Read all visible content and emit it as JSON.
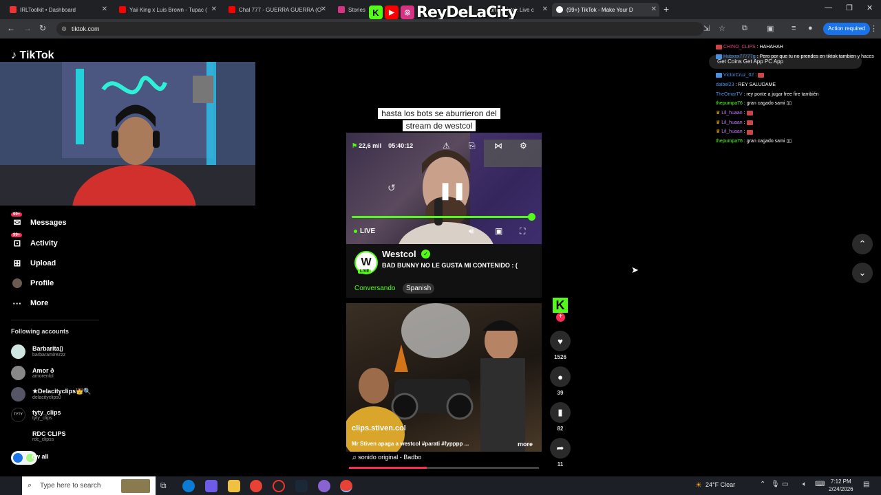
{
  "browser": {
    "tabs": [
      {
        "label": "IRLToolkit • Dashboard",
        "color": "#e33"
      },
      {
        "label": "Yaii King x Luis Brown - Tupac (",
        "color": "#f00"
      },
      {
        "label": "Chal 777 - GUERRA GUERRA (O",
        "color": "#f00"
      },
      {
        "label": "Stories",
        "color": "#d63384"
      },
      {
        "label": "am - Watch Live c",
        "color": "#53fc18"
      },
      {
        "label": "(99+) TikTok - Make Your D",
        "color": "#fff"
      }
    ],
    "url": "tiktok.com",
    "action_required": "Action required"
  },
  "overlay": {
    "name": "ReyDeLaCity"
  },
  "tiktok": {
    "logo": "TikTok",
    "nav": [
      {
        "label": "Messages",
        "badge": "99+",
        "icon": "message-icon"
      },
      {
        "label": "Activity",
        "badge": "99+",
        "icon": "inbox-icon"
      },
      {
        "label": "Upload",
        "badge": "",
        "icon": "upload-icon"
      },
      {
        "label": "Profile",
        "badge": "",
        "icon": "profile-icon"
      },
      {
        "label": "More",
        "badge": "",
        "icon": "more-icon"
      }
    ],
    "following_title": "Following accounts",
    "following": [
      {
        "name": "Barbarita▯",
        "user": "barbaramirezzz",
        "color": "#cfe6e0"
      },
      {
        "name": "Amor ð",
        "user": "amorenlol",
        "color": "#888"
      },
      {
        "name": "★Delacityclips👑🔍",
        "user": "delacityclips0",
        "color": "#556"
      },
      {
        "name": "tyty_clips",
        "user": "tyty_clips",
        "color": "#000"
      },
      {
        "name": "RDC CLIPS",
        "user": "rdc_clipss",
        "color": "#000"
      }
    ],
    "see_all": "ew all"
  },
  "feed": {
    "caption_line1": "hasta los bots se aburrieron del",
    "caption_line2": "stream de westcol",
    "live": {
      "viewers": "22,6 mil",
      "time": "05:40:12",
      "live_label": "LIVE",
      "progress": 1.0
    },
    "streamer": {
      "avatar_letter": "W",
      "live_badge": "LIVE",
      "name": "Westcol",
      "title": "BAD BUNNY NO LE GUSTA MI CONTENIDO : (",
      "category": "Conversando",
      "language": "Spanish"
    },
    "video2": {
      "user": "clips.stiven.col",
      "description": "Mr Stiven apaga a westcol #parati #fypppp ...",
      "more": "more",
      "music": "♫ sonido original - Badbo",
      "progress": 0.41
    },
    "actions": {
      "likes": "1526",
      "comments": "39",
      "saves": "82",
      "shares": "11"
    }
  },
  "chat": {
    "get_app": "Get Coins   Get App   PC App",
    "messages": [
      {
        "user": "CHINO_CLIPS",
        "text": ": HAHAHAH",
        "color": "#e0407f"
      },
      {
        "user": "Hubxxx77777g",
        "text": ": Pero por que tu no prendes en tiktok tambien y haces",
        "color": "#4a90e2"
      },
      {
        "user": "VictorCruz_02",
        "text": ":",
        "color": "#4a90e2"
      },
      {
        "user": "daibel23",
        "text": ": REY SALUDAME",
        "color": "#4a90e2"
      },
      {
        "user": "TheOmarTV",
        "text": ": rey ponte a jugar free fire también",
        "color": "#4a90e2"
      },
      {
        "user": "thepumpa76",
        "text": ": gran cagado sami ▯▯",
        "color": "#53fc18"
      },
      {
        "user": "Lil_huaan",
        "text": ":",
        "color": "#c77dff"
      },
      {
        "user": "Lil_huaan",
        "text": ":",
        "color": "#c77dff"
      },
      {
        "user": "Lil_huaan",
        "text": ":",
        "color": "#c77dff"
      },
      {
        "user": "thepumpa76",
        "text": ": gran cagado sami ▯▯",
        "color": "#53fc18"
      }
    ]
  },
  "taskbar": {
    "search": "Type here to search",
    "weather": "24°F  Clear",
    "time": "7:12 PM",
    "date": "2/24/2026"
  }
}
